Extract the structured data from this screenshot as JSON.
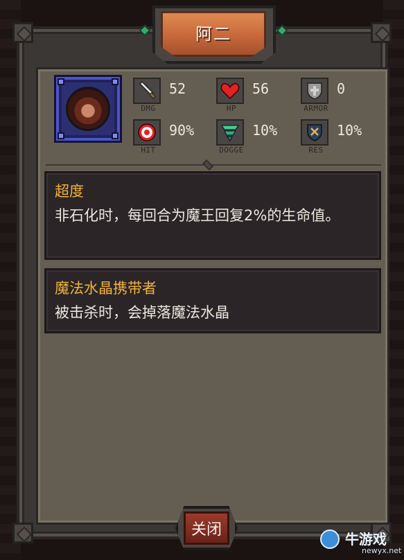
{
  "window": {
    "title": "阿二"
  },
  "portrait": {
    "icon": "hero-portrait-icon"
  },
  "stats": [
    {
      "icon": "sword-icon",
      "value": "52",
      "label": "DMG",
      "color": "#d9d9d9"
    },
    {
      "icon": "heart-icon",
      "value": "56",
      "label": "HP",
      "color": "#e02424"
    },
    {
      "icon": "shield-icon",
      "value": "0",
      "label": "ARMOR",
      "color": "#9a9a9a"
    },
    {
      "icon": "target-icon",
      "value": "90%",
      "label": "HIT",
      "color": "#e02424"
    },
    {
      "icon": "tornado-icon",
      "value": "10%",
      "label": "DOGGE",
      "color": "#3fd08a"
    },
    {
      "icon": "rune-shield-icon",
      "value": "10%",
      "label": "RES",
      "color": "#4a6fa8"
    }
  ],
  "abilities": [
    {
      "title": "超度",
      "desc": "非石化时，每回合为魔王回复2%的生命值。"
    },
    {
      "title": "魔法水晶携带者",
      "desc": "被击杀时，会掉落魔法水晶"
    }
  ],
  "buttons": {
    "close_label": "关闭"
  },
  "watermark": {
    "name": "牛游戏",
    "url": "newyx.net"
  },
  "colors": {
    "accent": "#f1b23c",
    "title_banner": "#c7683a",
    "panel": "#635e51"
  }
}
